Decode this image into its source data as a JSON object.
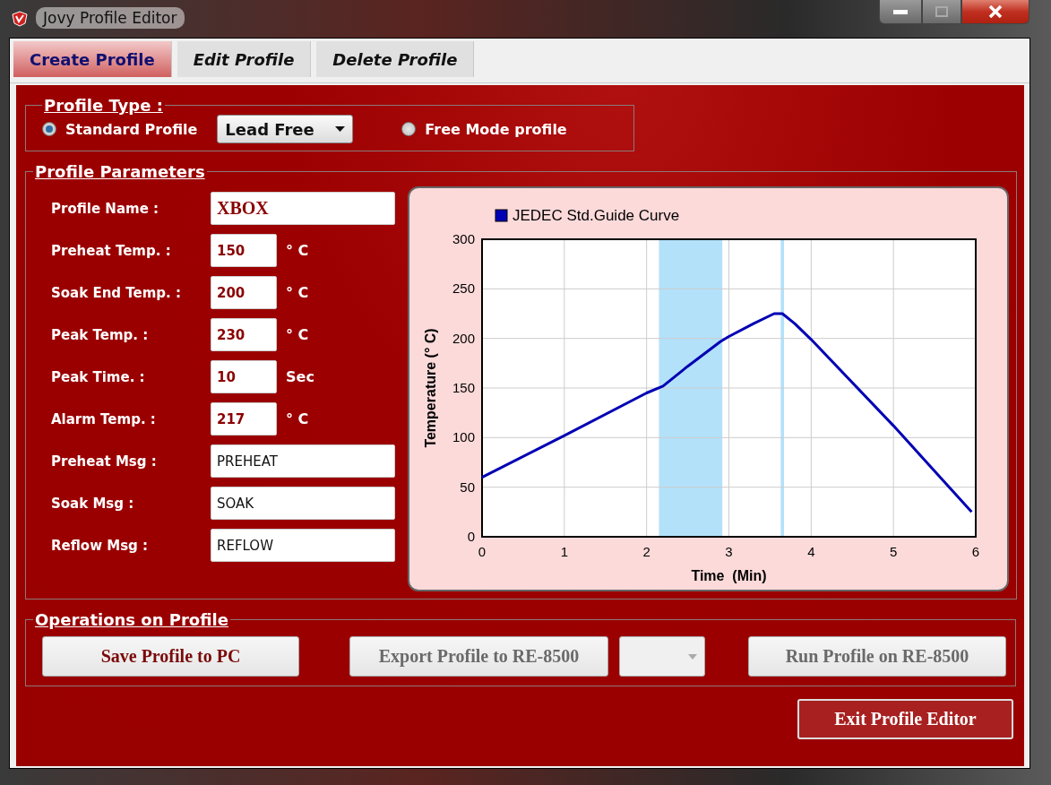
{
  "window": {
    "title": "Jovy Profile Editor"
  },
  "tabs": [
    {
      "label": "Create Profile",
      "selected": true
    },
    {
      "label": "Edit Profile",
      "selected": false
    },
    {
      "label": "Delete Profile",
      "selected": false
    }
  ],
  "profile_type": {
    "legend": "Profile Type :",
    "options": [
      {
        "label": "Standard Profile",
        "selected": true,
        "dropdown": "Lead Free"
      },
      {
        "label": "Free Mode profile",
        "selected": false
      }
    ]
  },
  "parameters": {
    "legend": "Profile Parameters",
    "fields": [
      {
        "label": "Profile Name :",
        "value": "XBOX",
        "kind": "name"
      },
      {
        "label": "Preheat Temp. :",
        "value": "150",
        "unit": "° C",
        "kind": "number"
      },
      {
        "label": "Soak End Temp. :",
        "value": "200",
        "unit": "° C",
        "kind": "number"
      },
      {
        "label": "Peak Temp. :",
        "value": "230",
        "unit": "° C",
        "kind": "number"
      },
      {
        "label": "Peak Time. :",
        "value": "10",
        "unit": "Sec",
        "kind": "number"
      },
      {
        "label": "Alarm Temp. :",
        "value": "217",
        "unit": "° C",
        "kind": "number"
      },
      {
        "label": "Preheat Msg :",
        "value": "PREHEAT",
        "kind": "message"
      },
      {
        "label": "Soak Msg :",
        "value": "SOAK",
        "kind": "message"
      },
      {
        "label": "Reflow Msg :",
        "value": "REFLOW",
        "kind": "message"
      }
    ],
    "chart_data": {
      "type": "line",
      "xlabel": "Time  (Min)",
      "ylabel": "Temperature (° C)",
      "x": [
        0,
        1,
        2,
        2.2,
        2.5,
        2.9,
        3,
        3.3,
        3.55,
        3.65,
        3.8,
        4,
        5,
        5.95
      ],
      "series": [
        {
          "name": "JEDEC Std.Guide Curve",
          "color": "#0000b4",
          "values": [
            60,
            102,
            145,
            152,
            172,
            197,
            202,
            215,
            225,
            225,
            215,
            199,
            112,
            25
          ]
        }
      ],
      "xlim": [
        0,
        6
      ],
      "ylim": [
        0,
        300
      ],
      "xticks": [
        0,
        1,
        2,
        3,
        4,
        5,
        6
      ],
      "yticks": [
        0,
        50,
        100,
        150,
        200,
        250,
        300
      ],
      "grid": true,
      "bands": [
        {
          "axis": "x",
          "from": 2.15,
          "to": 2.92,
          "color": "#b3e1fa"
        },
        {
          "axis": "x",
          "from": 3.63,
          "to": 3.67,
          "color": "#b3e1fa"
        }
      ]
    }
  },
  "operations": {
    "legend": "Operations on Profile",
    "buttons": [
      {
        "label": "Save Profile to PC",
        "disabled": false
      },
      {
        "label": "Export Profile to RE-8500",
        "disabled": true
      },
      {
        "kind": "dropdown",
        "disabled": true
      },
      {
        "label": "Run Profile on RE-8500",
        "disabled": true
      }
    ]
  },
  "exit_button": "Exit Profile Editor"
}
